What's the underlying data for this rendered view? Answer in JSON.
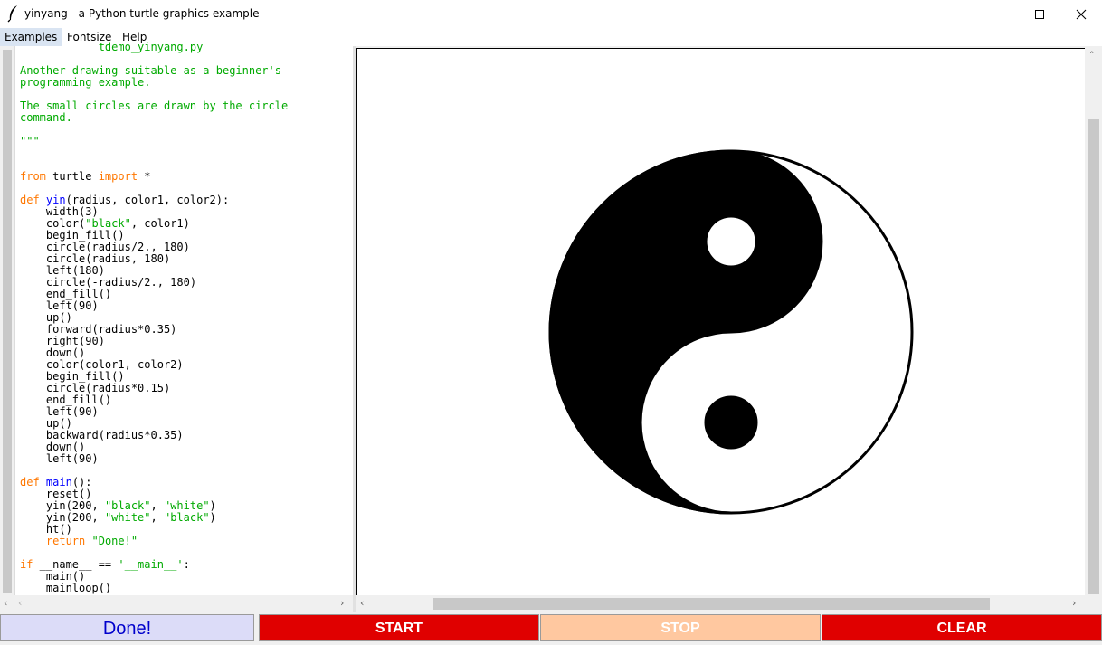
{
  "window": {
    "title": "yinyang - a Python turtle graphics example",
    "icon": "feather-icon",
    "controls": [
      "minimize-icon",
      "maximize-icon",
      "close-icon"
    ]
  },
  "menu": [
    {
      "label": "Examples",
      "active": true
    },
    {
      "label": "Fontsize",
      "active": false
    },
    {
      "label": "Help",
      "active": false
    }
  ],
  "code_lines": [
    {
      "indent": "",
      "tokens": [
        {
          "t": "            tdemo_yinyang.py",
          "c": "str"
        }
      ]
    },
    {
      "indent": "",
      "tokens": []
    },
    {
      "indent": "",
      "tokens": [
        {
          "t": "Another drawing suitable as a beginner's",
          "c": "str"
        }
      ]
    },
    {
      "indent": "",
      "tokens": [
        {
          "t": "programming example.",
          "c": "str"
        }
      ]
    },
    {
      "indent": "",
      "tokens": []
    },
    {
      "indent": "",
      "tokens": [
        {
          "t": "The small circles are drawn by the circle",
          "c": "str"
        }
      ]
    },
    {
      "indent": "",
      "tokens": [
        {
          "t": "command.",
          "c": "str"
        }
      ]
    },
    {
      "indent": "",
      "tokens": []
    },
    {
      "indent": "",
      "tokens": [
        {
          "t": "\"\"\"",
          "c": "str"
        }
      ]
    },
    {
      "indent": "",
      "tokens": []
    },
    {
      "indent": "",
      "tokens": []
    },
    {
      "indent": "",
      "tokens": [
        {
          "t": "from",
          "c": "kw"
        },
        {
          "t": " turtle ",
          "c": ""
        },
        {
          "t": "import",
          "c": "kw"
        },
        {
          "t": " *",
          "c": ""
        }
      ]
    },
    {
      "indent": "",
      "tokens": []
    },
    {
      "indent": "",
      "tokens": [
        {
          "t": "def",
          "c": "kw"
        },
        {
          "t": " ",
          "c": ""
        },
        {
          "t": "yin",
          "c": "def"
        },
        {
          "t": "(radius, color1, color2):",
          "c": ""
        }
      ]
    },
    {
      "indent": "    ",
      "tokens": [
        {
          "t": "width(3)",
          "c": ""
        }
      ]
    },
    {
      "indent": "    ",
      "tokens": [
        {
          "t": "color(",
          "c": ""
        },
        {
          "t": "\"black\"",
          "c": "str"
        },
        {
          "t": ", color1)",
          "c": ""
        }
      ]
    },
    {
      "indent": "    ",
      "tokens": [
        {
          "t": "begin_fill()",
          "c": ""
        }
      ]
    },
    {
      "indent": "    ",
      "tokens": [
        {
          "t": "circle(radius/2., 180)",
          "c": ""
        }
      ]
    },
    {
      "indent": "    ",
      "tokens": [
        {
          "t": "circle(radius, 180)",
          "c": ""
        }
      ]
    },
    {
      "indent": "    ",
      "tokens": [
        {
          "t": "left(180)",
          "c": ""
        }
      ]
    },
    {
      "indent": "    ",
      "tokens": [
        {
          "t": "circle(-radius/2., 180)",
          "c": ""
        }
      ]
    },
    {
      "indent": "    ",
      "tokens": [
        {
          "t": "end_fill()",
          "c": ""
        }
      ]
    },
    {
      "indent": "    ",
      "tokens": [
        {
          "t": "left(90)",
          "c": ""
        }
      ]
    },
    {
      "indent": "    ",
      "tokens": [
        {
          "t": "up()",
          "c": ""
        }
      ]
    },
    {
      "indent": "    ",
      "tokens": [
        {
          "t": "forward(radius*0.35)",
          "c": ""
        }
      ]
    },
    {
      "indent": "    ",
      "tokens": [
        {
          "t": "right(90)",
          "c": ""
        }
      ]
    },
    {
      "indent": "    ",
      "tokens": [
        {
          "t": "down()",
          "c": ""
        }
      ]
    },
    {
      "indent": "    ",
      "tokens": [
        {
          "t": "color(color1, color2)",
          "c": ""
        }
      ]
    },
    {
      "indent": "    ",
      "tokens": [
        {
          "t": "begin_fill()",
          "c": ""
        }
      ]
    },
    {
      "indent": "    ",
      "tokens": [
        {
          "t": "circle(radius*0.15)",
          "c": ""
        }
      ]
    },
    {
      "indent": "    ",
      "tokens": [
        {
          "t": "end_fill()",
          "c": ""
        }
      ]
    },
    {
      "indent": "    ",
      "tokens": [
        {
          "t": "left(90)",
          "c": ""
        }
      ]
    },
    {
      "indent": "    ",
      "tokens": [
        {
          "t": "up()",
          "c": ""
        }
      ]
    },
    {
      "indent": "    ",
      "tokens": [
        {
          "t": "backward(radius*0.35)",
          "c": ""
        }
      ]
    },
    {
      "indent": "    ",
      "tokens": [
        {
          "t": "down()",
          "c": ""
        }
      ]
    },
    {
      "indent": "    ",
      "tokens": [
        {
          "t": "left(90)",
          "c": ""
        }
      ]
    },
    {
      "indent": "",
      "tokens": []
    },
    {
      "indent": "",
      "tokens": [
        {
          "t": "def",
          "c": "kw"
        },
        {
          "t": " ",
          "c": ""
        },
        {
          "t": "main",
          "c": "def"
        },
        {
          "t": "():",
          "c": ""
        }
      ]
    },
    {
      "indent": "    ",
      "tokens": [
        {
          "t": "reset()",
          "c": ""
        }
      ]
    },
    {
      "indent": "    ",
      "tokens": [
        {
          "t": "yin(200, ",
          "c": ""
        },
        {
          "t": "\"black\"",
          "c": "str"
        },
        {
          "t": ", ",
          "c": ""
        },
        {
          "t": "\"white\"",
          "c": "str"
        },
        {
          "t": ")",
          "c": ""
        }
      ]
    },
    {
      "indent": "    ",
      "tokens": [
        {
          "t": "yin(200, ",
          "c": ""
        },
        {
          "t": "\"white\"",
          "c": "str"
        },
        {
          "t": ", ",
          "c": ""
        },
        {
          "t": "\"black\"",
          "c": "str"
        },
        {
          "t": ")",
          "c": ""
        }
      ]
    },
    {
      "indent": "    ",
      "tokens": [
        {
          "t": "ht()",
          "c": ""
        }
      ]
    },
    {
      "indent": "    ",
      "tokens": [
        {
          "t": "return",
          "c": "kw"
        },
        {
          "t": " ",
          "c": ""
        },
        {
          "t": "\"Done!\"",
          "c": "str"
        }
      ]
    },
    {
      "indent": "",
      "tokens": []
    },
    {
      "indent": "",
      "tokens": [
        {
          "t": "if",
          "c": "kw"
        },
        {
          "t": " __name__ == ",
          "c": ""
        },
        {
          "t": "'__main__'",
          "c": "str"
        },
        {
          "t": ":",
          "c": ""
        }
      ]
    },
    {
      "indent": "    ",
      "tokens": [
        {
          "t": "main()",
          "c": ""
        }
      ]
    },
    {
      "indent": "    ",
      "tokens": [
        {
          "t": "mainloop()",
          "c": ""
        }
      ]
    }
  ],
  "buttons": {
    "done": "Done!",
    "start": "START",
    "stop": "STOP",
    "clear": "CLEAR"
  },
  "colors": {
    "string": "#00aa00",
    "keyword": "#ff7700",
    "definition": "#0000ff",
    "button_red": "#e00000",
    "button_stop": "#ffc8a0",
    "done_text": "#0000cc"
  },
  "drawing": {
    "radius": 200,
    "ring_width": 3,
    "yin_color": "black",
    "yang_color": "white"
  }
}
